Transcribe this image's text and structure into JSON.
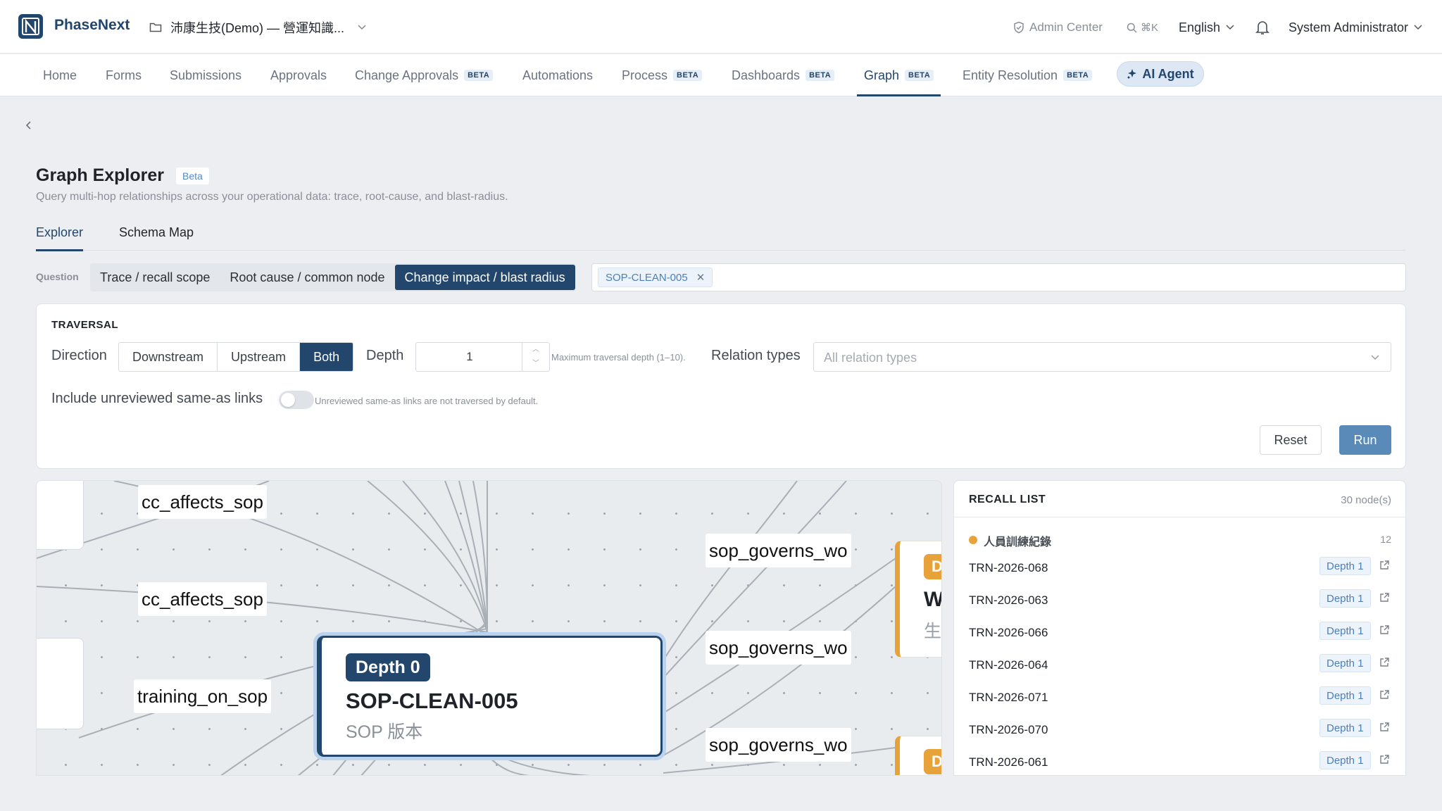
{
  "app": {
    "name": "PhaseNext",
    "workspace": "沛康生技(Demo) — 營運知識..."
  },
  "topbar": {
    "admin_center": "Admin Center",
    "search_shortcut": "⌘K",
    "language": "English",
    "user": "System Administrator"
  },
  "nav": {
    "items": [
      {
        "label": "Home",
        "beta": ""
      },
      {
        "label": "Forms",
        "beta": ""
      },
      {
        "label": "Submissions",
        "beta": ""
      },
      {
        "label": "Approvals",
        "beta": ""
      },
      {
        "label": "Change Approvals",
        "beta": "BETA"
      },
      {
        "label": "Automations",
        "beta": ""
      },
      {
        "label": "Process",
        "beta": "BETA"
      },
      {
        "label": "Dashboards",
        "beta": "BETA"
      },
      {
        "label": "Graph",
        "beta": "BETA",
        "active": true
      },
      {
        "label": "Entity Resolution",
        "beta": "BETA"
      }
    ],
    "ai_agent": "AI Agent"
  },
  "page": {
    "title": "Graph Explorer",
    "beta": "Beta",
    "subtitle": "Query multi-hop relationships across your operational data: trace, root-cause, and blast-radius.",
    "tabs": [
      "Explorer",
      "Schema Map"
    ],
    "active_tab": "Explorer"
  },
  "question": {
    "label": "Question",
    "options": [
      "Trace / recall scope",
      "Root cause / common node",
      "Change impact / blast radius"
    ],
    "active": "Change impact / blast radius",
    "seed_tag": "SOP-CLEAN-005"
  },
  "traversal": {
    "title": "TRAVERSAL",
    "direction_label": "Direction",
    "directions": [
      "Downstream",
      "Upstream",
      "Both"
    ],
    "active_direction": "Both",
    "depth_label": "Depth",
    "depth_value": "1",
    "depth_hint": "Maximum traversal depth (1–10).",
    "relation_label": "Relation types",
    "relation_placeholder": "All relation types",
    "unreviewed_label": "Include unreviewed same-as links",
    "unreviewed_hint": "Unreviewed same-as links are not traversed by default.",
    "unreviewed_enabled": false,
    "reset": "Reset",
    "run": "Run"
  },
  "graph": {
    "center": {
      "depth": "Depth 0",
      "id": "SOP-CLEAN-005",
      "type": "SOP 版本"
    },
    "edge_labels": [
      "cc_affects_sop",
      "cc_affects_sop",
      "training_on_sop",
      "sop_governs_wo",
      "sop_governs_wo",
      "sop_governs_wo"
    ],
    "side_nodes": [
      {
        "badge": "D",
        "title": "W",
        "sub": "生"
      },
      {
        "badge": "D"
      }
    ]
  },
  "recall": {
    "title": "RECALL LIST",
    "count": "30 node(s)",
    "group": {
      "name": "人員訓練紀錄",
      "count": "12",
      "color": "#e8a23a"
    },
    "rows": [
      {
        "id": "TRN-2026-068",
        "depth": "Depth 1"
      },
      {
        "id": "TRN-2026-063",
        "depth": "Depth 1"
      },
      {
        "id": "TRN-2026-066",
        "depth": "Depth 1"
      },
      {
        "id": "TRN-2026-064",
        "depth": "Depth 1"
      },
      {
        "id": "TRN-2026-071",
        "depth": "Depth 1"
      },
      {
        "id": "TRN-2026-070",
        "depth": "Depth 1"
      },
      {
        "id": "TRN-2026-061",
        "depth": "Depth 1"
      }
    ]
  },
  "colors": {
    "brand": "#23466d",
    "accent_blue": "#5a8ab8",
    "group_orange": "#e8a23a"
  },
  "icons": [
    "logo-icon",
    "folder-icon",
    "chevron-down-icon",
    "shield-icon",
    "search-icon",
    "bell-icon",
    "sparkle-icon",
    "chevron-left-icon",
    "close-icon",
    "external-link-icon"
  ]
}
